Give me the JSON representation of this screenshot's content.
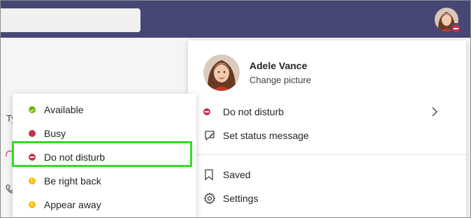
{
  "header": {
    "search_placeholder": "",
    "avatar_status": "Do not disturb"
  },
  "profile": {
    "name": "Adele Vance",
    "change_picture": "Change picture",
    "status_label": "Do not disturb",
    "set_status_message": "Set status message",
    "saved": "Saved",
    "settings": "Settings"
  },
  "background": {
    "partial_text": "Ty"
  },
  "status_menu": {
    "items": [
      {
        "label": "Available",
        "color": "#6bb700",
        "icon": "available-check-icon"
      },
      {
        "label": "Busy",
        "color": "#c4314b",
        "icon": "busy-dot-icon"
      },
      {
        "label": "Do not disturb",
        "color": "#c4314b",
        "icon": "dnd-minus-icon"
      },
      {
        "label": "Be right back",
        "color": "#f8c10e",
        "icon": "clock-icon"
      },
      {
        "label": "Appear away",
        "color": "#f8c10e",
        "icon": "clock-icon"
      }
    ],
    "highlighted_index": 2
  },
  "colors": {
    "header_bg": "#464775",
    "highlight_border": "#33dd22",
    "accent": "#8b8cc7"
  }
}
